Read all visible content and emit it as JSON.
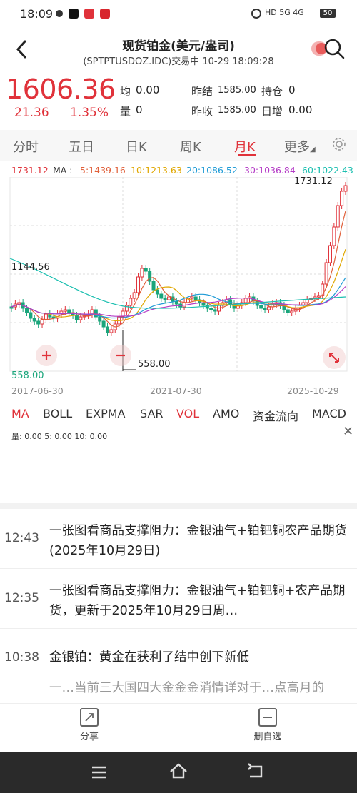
{
  "status_bar": {
    "time": "18:09",
    "right_text": "HD 5G 4G",
    "battery": "50"
  },
  "header": {
    "title": "现货铂金(美元/盎司)",
    "subtitle": "(SPTPTUSDOZ.IDC)交易中 10-29 18:09:28"
  },
  "quote": {
    "price": "1606.36",
    "change": "21.36",
    "change_pct": "1.35%",
    "avg_label": "均",
    "avg_value": "0.00",
    "vol_label": "量",
    "vol_value": "0",
    "prev_settle_label": "昨结",
    "prev_settle_value": "1585.00",
    "open_interest_label": "持仓",
    "open_interest_value": "0",
    "prev_close_label": "昨收",
    "prev_close_value": "1585.00",
    "daily_inc_label": "日增",
    "daily_inc_value": "0.00"
  },
  "tabs": [
    "分时",
    "五日",
    "日K",
    "周K",
    "月K",
    "更多"
  ],
  "active_tab": "月K",
  "ma_row": {
    "price": "1731.12",
    "label": "MA :",
    "ma5": "5:1439.16",
    "ma10": "10:1213.63",
    "ma20": "20:1086.52",
    "ma30": "30:1036.84",
    "ma60": "60:1022.43"
  },
  "colors": {
    "up": "#e0323a",
    "down": "#1aa57b",
    "ma5": "#e0603a",
    "ma10": "#e0a700",
    "ma20": "#1f9bd6",
    "ma30": "#b43bc6",
    "ma60": "#1bbfb0"
  },
  "chart": {
    "high_label": "1731.12",
    "mid_label": "1144.56",
    "low_label": "558.00",
    "low_marker": "558.00",
    "dates": [
      "2017-06-30",
      "2021-07-30",
      "2025-10-29"
    ]
  },
  "indicators": [
    "MA",
    "BOLL",
    "EXPMA",
    "SAR",
    "VOL",
    "AMO",
    "资金流向",
    "MACD"
  ],
  "vol_line": "量: 0.00  5: 0.00  10: 0.00",
  "news": [
    {
      "time": "12:43",
      "text": "一张图看商品支撑阻力：金银油气+铂钯铜农产品期货(2025年10月29日)"
    },
    {
      "time": "12:35",
      "text": "一张图看商品支撑阻力：金银油气+铂钯铜+农产品期货，更新于2025年10月29日周…"
    },
    {
      "time": "10:38",
      "text": "金银铂：黄金在获利了结中创下新低"
    },
    {
      "time": "",
      "text": "一…当前三大国四大金金金消情详对于…点高月的"
    }
  ],
  "bottom": {
    "share_label": "分享",
    "remove_label": "删自选"
  },
  "icons": {
    "back": "chevron-left-icon",
    "search": "search-icon",
    "settings": "gear-icon",
    "expand": "expand-icon",
    "zoom_in": "plus-icon",
    "zoom_out": "minus-icon",
    "close": "close-icon"
  }
}
